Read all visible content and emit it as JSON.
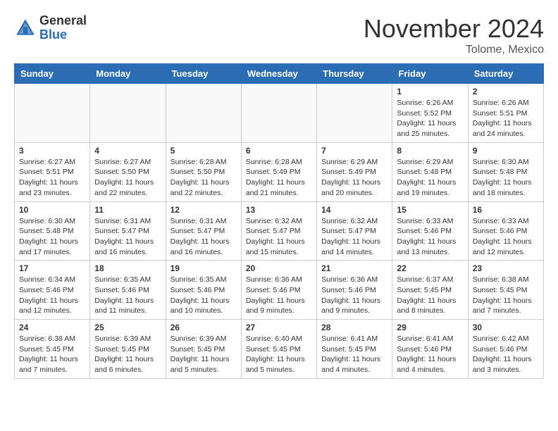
{
  "header": {
    "logo_line1": "General",
    "logo_line2": "Blue",
    "month": "November 2024",
    "location": "Tolome, Mexico"
  },
  "weekdays": [
    "Sunday",
    "Monday",
    "Tuesday",
    "Wednesday",
    "Thursday",
    "Friday",
    "Saturday"
  ],
  "weeks": [
    [
      {
        "day": "",
        "empty": true
      },
      {
        "day": "",
        "empty": true
      },
      {
        "day": "",
        "empty": true
      },
      {
        "day": "",
        "empty": true
      },
      {
        "day": "",
        "empty": true
      },
      {
        "day": "1",
        "sunrise": "Sunrise: 6:26 AM",
        "sunset": "Sunset: 5:52 PM",
        "daylight": "Daylight: 11 hours and 25 minutes."
      },
      {
        "day": "2",
        "sunrise": "Sunrise: 6:26 AM",
        "sunset": "Sunset: 5:51 PM",
        "daylight": "Daylight: 11 hours and 24 minutes."
      }
    ],
    [
      {
        "day": "3",
        "sunrise": "Sunrise: 6:27 AM",
        "sunset": "Sunset: 5:51 PM",
        "daylight": "Daylight: 11 hours and 23 minutes."
      },
      {
        "day": "4",
        "sunrise": "Sunrise: 6:27 AM",
        "sunset": "Sunset: 5:50 PM",
        "daylight": "Daylight: 11 hours and 22 minutes."
      },
      {
        "day": "5",
        "sunrise": "Sunrise: 6:28 AM",
        "sunset": "Sunset: 5:50 PM",
        "daylight": "Daylight: 11 hours and 22 minutes."
      },
      {
        "day": "6",
        "sunrise": "Sunrise: 6:28 AM",
        "sunset": "Sunset: 5:49 PM",
        "daylight": "Daylight: 11 hours and 21 minutes."
      },
      {
        "day": "7",
        "sunrise": "Sunrise: 6:29 AM",
        "sunset": "Sunset: 5:49 PM",
        "daylight": "Daylight: 11 hours and 20 minutes."
      },
      {
        "day": "8",
        "sunrise": "Sunrise: 6:29 AM",
        "sunset": "Sunset: 5:48 PM",
        "daylight": "Daylight: 11 hours and 19 minutes."
      },
      {
        "day": "9",
        "sunrise": "Sunrise: 6:30 AM",
        "sunset": "Sunset: 5:48 PM",
        "daylight": "Daylight: 11 hours and 18 minutes."
      }
    ],
    [
      {
        "day": "10",
        "sunrise": "Sunrise: 6:30 AM",
        "sunset": "Sunset: 5:48 PM",
        "daylight": "Daylight: 11 hours and 17 minutes."
      },
      {
        "day": "11",
        "sunrise": "Sunrise: 6:31 AM",
        "sunset": "Sunset: 5:47 PM",
        "daylight": "Daylight: 11 hours and 16 minutes."
      },
      {
        "day": "12",
        "sunrise": "Sunrise: 6:31 AM",
        "sunset": "Sunset: 5:47 PM",
        "daylight": "Daylight: 11 hours and 16 minutes."
      },
      {
        "day": "13",
        "sunrise": "Sunrise: 6:32 AM",
        "sunset": "Sunset: 5:47 PM",
        "daylight": "Daylight: 11 hours and 15 minutes."
      },
      {
        "day": "14",
        "sunrise": "Sunrise: 6:32 AM",
        "sunset": "Sunset: 5:47 PM",
        "daylight": "Daylight: 11 hours and 14 minutes."
      },
      {
        "day": "15",
        "sunrise": "Sunrise: 6:33 AM",
        "sunset": "Sunset: 5:46 PM",
        "daylight": "Daylight: 11 hours and 13 minutes."
      },
      {
        "day": "16",
        "sunrise": "Sunrise: 6:33 AM",
        "sunset": "Sunset: 5:46 PM",
        "daylight": "Daylight: 11 hours and 12 minutes."
      }
    ],
    [
      {
        "day": "17",
        "sunrise": "Sunrise: 6:34 AM",
        "sunset": "Sunset: 5:46 PM",
        "daylight": "Daylight: 11 hours and 12 minutes."
      },
      {
        "day": "18",
        "sunrise": "Sunrise: 6:35 AM",
        "sunset": "Sunset: 5:46 PM",
        "daylight": "Daylight: 11 hours and 11 minutes."
      },
      {
        "day": "19",
        "sunrise": "Sunrise: 6:35 AM",
        "sunset": "Sunset: 5:46 PM",
        "daylight": "Daylight: 11 hours and 10 minutes."
      },
      {
        "day": "20",
        "sunrise": "Sunrise: 6:36 AM",
        "sunset": "Sunset: 5:46 PM",
        "daylight": "Daylight: 11 hours and 9 minutes."
      },
      {
        "day": "21",
        "sunrise": "Sunrise: 6:36 AM",
        "sunset": "Sunset: 5:46 PM",
        "daylight": "Daylight: 11 hours and 9 minutes."
      },
      {
        "day": "22",
        "sunrise": "Sunrise: 6:37 AM",
        "sunset": "Sunset: 5:45 PM",
        "daylight": "Daylight: 11 hours and 8 minutes."
      },
      {
        "day": "23",
        "sunrise": "Sunrise: 6:38 AM",
        "sunset": "Sunset: 5:45 PM",
        "daylight": "Daylight: 11 hours and 7 minutes."
      }
    ],
    [
      {
        "day": "24",
        "sunrise": "Sunrise: 6:38 AM",
        "sunset": "Sunset: 5:45 PM",
        "daylight": "Daylight: 11 hours and 7 minutes."
      },
      {
        "day": "25",
        "sunrise": "Sunrise: 6:39 AM",
        "sunset": "Sunset: 5:45 PM",
        "daylight": "Daylight: 11 hours and 6 minutes."
      },
      {
        "day": "26",
        "sunrise": "Sunrise: 6:39 AM",
        "sunset": "Sunset: 5:45 PM",
        "daylight": "Daylight: 11 hours and 5 minutes."
      },
      {
        "day": "27",
        "sunrise": "Sunrise: 6:40 AM",
        "sunset": "Sunset: 5:45 PM",
        "daylight": "Daylight: 11 hours and 5 minutes."
      },
      {
        "day": "28",
        "sunrise": "Sunrise: 6:41 AM",
        "sunset": "Sunset: 5:45 PM",
        "daylight": "Daylight: 11 hours and 4 minutes."
      },
      {
        "day": "29",
        "sunrise": "Sunrise: 6:41 AM",
        "sunset": "Sunset: 5:46 PM",
        "daylight": "Daylight: 11 hours and 4 minutes."
      },
      {
        "day": "30",
        "sunrise": "Sunrise: 6:42 AM",
        "sunset": "Sunset: 5:46 PM",
        "daylight": "Daylight: 11 hours and 3 minutes."
      }
    ]
  ]
}
